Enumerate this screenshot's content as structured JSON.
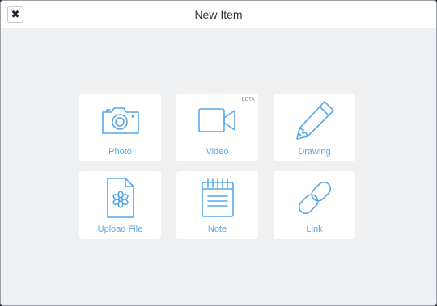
{
  "window": {
    "title": "New Item",
    "close_icon": "close-icon"
  },
  "theme": {
    "accent": "#5aa7e6",
    "background": "#eef0f2",
    "tile_background": "#ffffff"
  },
  "items": [
    {
      "label": "Photo",
      "icon": "camera-icon"
    },
    {
      "label": "Video",
      "icon": "video-camera-icon",
      "badge": "BETA"
    },
    {
      "label": "Drawing",
      "icon": "pencil-icon"
    },
    {
      "label": "Upload File",
      "icon": "file-icon"
    },
    {
      "label": "Note",
      "icon": "notepad-icon"
    },
    {
      "label": "Link",
      "icon": "link-icon"
    }
  ]
}
